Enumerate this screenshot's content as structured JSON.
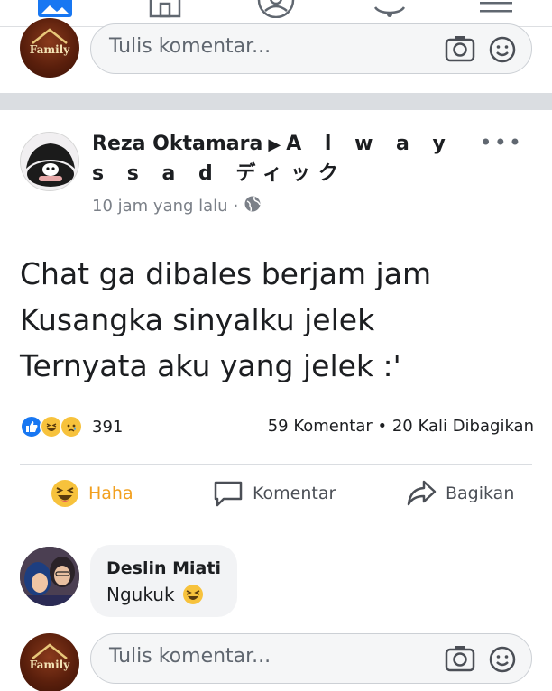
{
  "navbar": {
    "icons": [
      "photo-icon",
      "shop-icon",
      "profile-icon",
      "notifications-icon",
      "menu-icon"
    ]
  },
  "comment_box_top": {
    "placeholder": "Tulis komentar..."
  },
  "post": {
    "author": "Reza Oktamara",
    "group": "A l w a y s s a d ディック",
    "time": "10 jam yang lalu",
    "privacy_icon": "globe-icon",
    "text_lines": [
      "Chat ga dibales berjam jam",
      "Kusangka sinyalku jelek",
      "Ternyata aku yang jelek :'"
    ],
    "reactions": {
      "icons": [
        "like-icon",
        "haha-icon",
        "sad-icon"
      ],
      "count": "391"
    },
    "stats": "59 Komentar • 20 Kali Dibagikan",
    "actions": {
      "haha": "Haha",
      "comment": "Komentar",
      "share": "Bagikan"
    }
  },
  "reply": {
    "name": "Deslin Miati",
    "text": "Ngukuk"
  },
  "comment_box_bottom": {
    "placeholder": "Tulis komentar..."
  },
  "colors": {
    "haha_accent": "#f2a01f",
    "like_blue": "#1877f2",
    "divider": "#dadde1"
  }
}
